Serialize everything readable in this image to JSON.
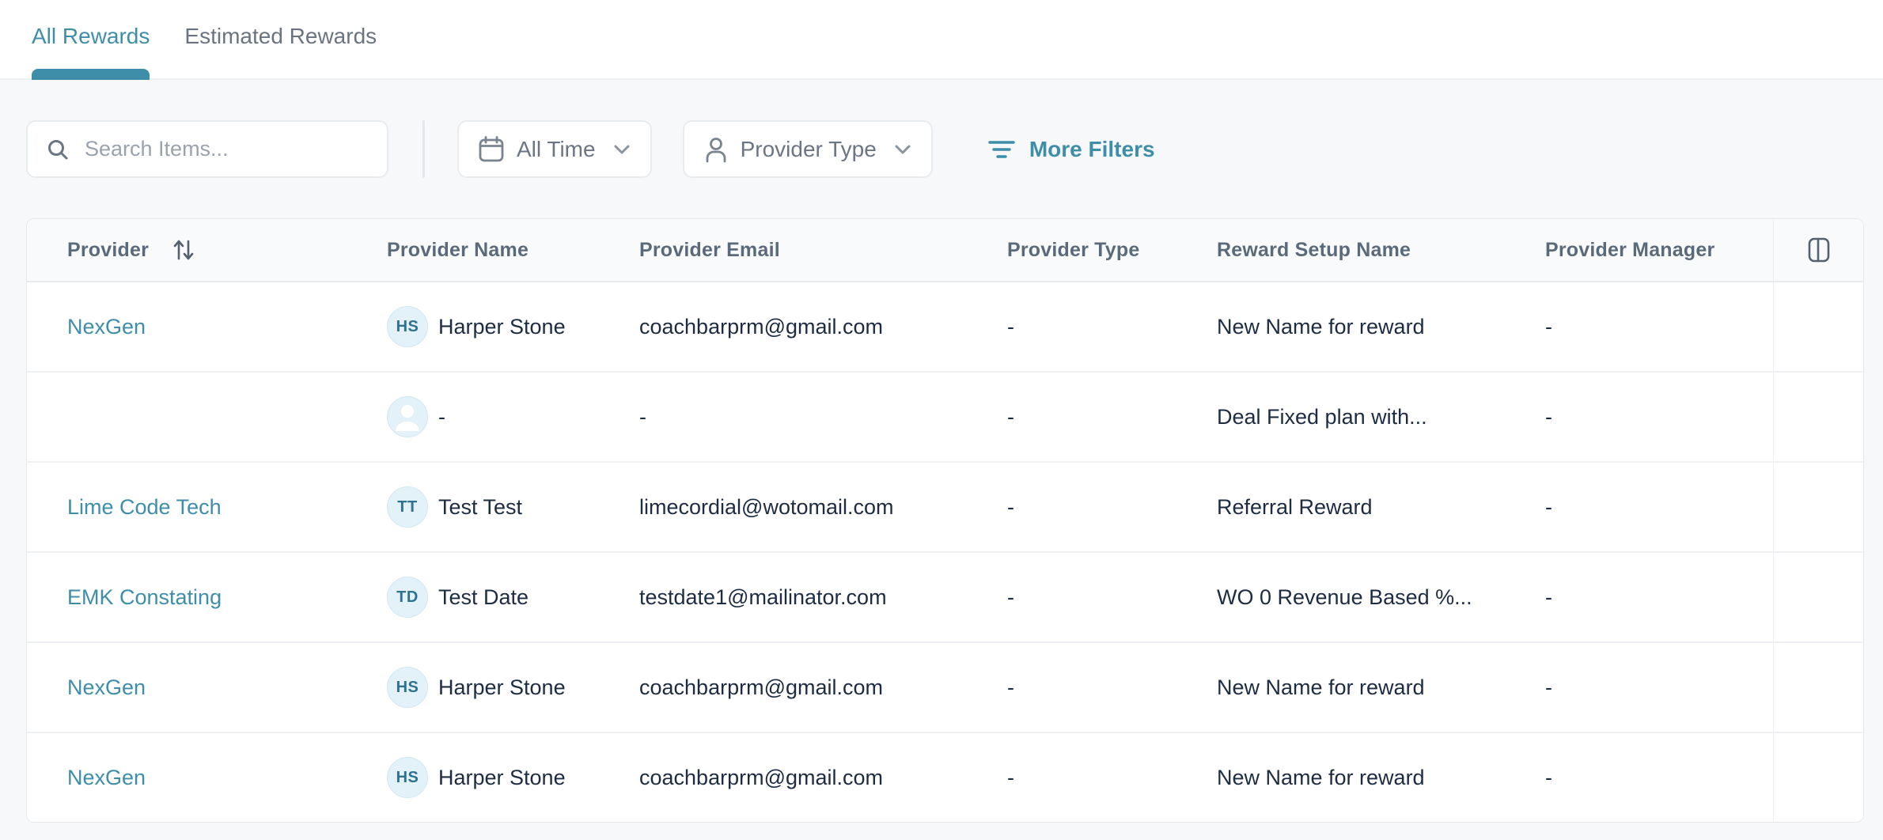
{
  "tabs": [
    {
      "label": "All Rewards",
      "active": true
    },
    {
      "label": "Estimated Rewards",
      "active": false
    }
  ],
  "filters": {
    "search_placeholder": "Search Items...",
    "time_filter_label": "All Time",
    "provider_type_filter_label": "Provider Type",
    "more_filters_label": "More Filters"
  },
  "icons": [
    "search-icon",
    "calendar-icon",
    "person-icon",
    "chevron-down-icon",
    "filter-lines-icon",
    "sort-arrows-icon",
    "columns-icon",
    "avatar-person-icon"
  ],
  "colors": {
    "accent_teal": "#3e8ea9",
    "dark_text": "#1d2c42",
    "header_text": "#5b6a7a",
    "muted_text": "#6b7583",
    "placeholder_text": "#9aa3ad",
    "avatar_bg": "#e3f1f9",
    "avatar_text": "#2d7390",
    "page_bg": "#f7f8f9",
    "table_header_bg": "#f8fafb",
    "border": "#e9ecef"
  },
  "table": {
    "columns": [
      "Provider",
      "Provider Name",
      "Provider Email",
      "Provider Type",
      "Reward Setup Name",
      "Provider Manager"
    ],
    "rows": [
      {
        "provider": "NexGen",
        "initials": "HS",
        "name": "Harper Stone",
        "email": "coachbarprm@gmail.com",
        "type": "-",
        "reward": "New Name for reward",
        "manager": "-"
      },
      {
        "provider": "",
        "initials": "",
        "name": "-",
        "email": "-",
        "type": "-",
        "reward": "Deal Fixed plan with...",
        "manager": "-"
      },
      {
        "provider": "Lime Code Tech",
        "initials": "TT",
        "name": "Test Test",
        "email": "limecordial@wotomail.com",
        "type": "-",
        "reward": "Referral Reward",
        "manager": "-"
      },
      {
        "provider": "EMK Constating",
        "initials": "TD",
        "name": "Test Date",
        "email": "testdate1@mailinator.com",
        "type": "-",
        "reward": "WO 0 Revenue Based %...",
        "manager": "-"
      },
      {
        "provider": "NexGen",
        "initials": "HS",
        "name": "Harper Stone",
        "email": "coachbarprm@gmail.com",
        "type": "-",
        "reward": "New Name for reward",
        "manager": "-"
      },
      {
        "provider": "NexGen",
        "initials": "HS",
        "name": "Harper Stone",
        "email": "coachbarprm@gmail.com",
        "type": "-",
        "reward": "New Name for reward",
        "manager": "-"
      }
    ]
  }
}
